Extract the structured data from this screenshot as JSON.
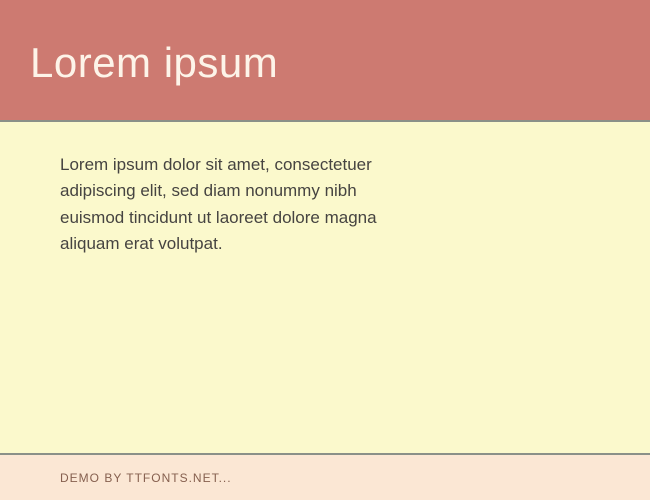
{
  "header": {
    "title": "Lorem ipsum"
  },
  "body": {
    "paragraph": "Lorem ipsum dolor sit amet, consectetuer adipiscing elit, sed diam nonummy nibh euismod tincidunt ut laoreet dolore magna aliquam erat volutpat."
  },
  "footer": {
    "text": "DEMO BY TTFONTS.NET..."
  }
}
